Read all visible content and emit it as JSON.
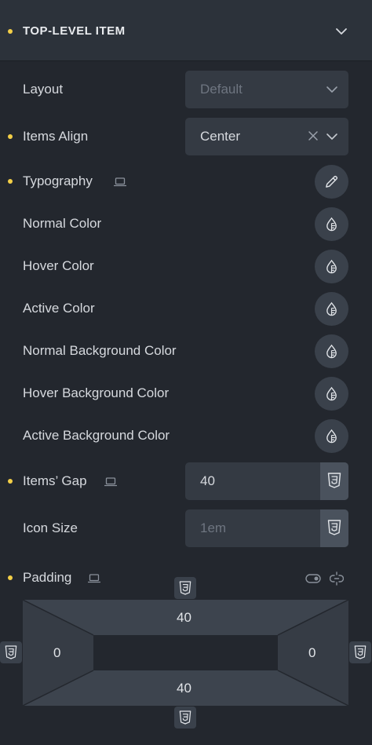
{
  "header": {
    "title": "TOP-LEVEL ITEM"
  },
  "layout": {
    "label": "Layout",
    "value": "Default"
  },
  "items_align": {
    "label": "Items Align",
    "value": "Center"
  },
  "typography": {
    "label": "Typography"
  },
  "colors": {
    "normal": "Normal Color",
    "hover": "Hover Color",
    "active": "Active Color",
    "normal_bg": "Normal Background Color",
    "hover_bg": "Hover Background Color",
    "active_bg": "Active Background Color"
  },
  "items_gap": {
    "label": "Items’ Gap",
    "value": "40"
  },
  "icon_size": {
    "label": "Icon Size",
    "placeholder": "1em"
  },
  "padding": {
    "label": "Padding",
    "top": "40",
    "right": "0",
    "bottom": "40",
    "left": "0"
  },
  "theme": {
    "accent_dot": "#f3cf47",
    "panel_bg": "#23272e",
    "control_bg": "#343a43"
  }
}
